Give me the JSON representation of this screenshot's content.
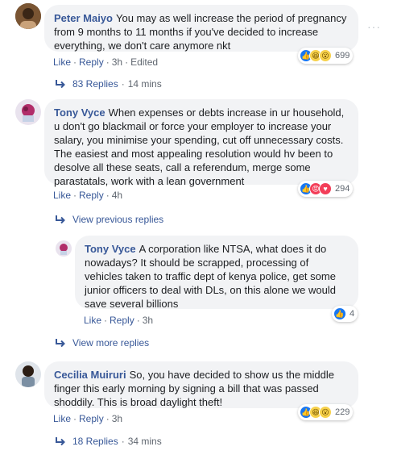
{
  "comments": [
    {
      "author": "Peter Maiyo",
      "text": "You may as well increase the period of pregnancy from 9 months to 11 months if you've decided to increase everything, we don't care anymore nkt",
      "actions": {
        "like": "Like",
        "reply": "Reply",
        "time": "3h",
        "edited": "Edited"
      },
      "reactions": {
        "icons": [
          "like-icon",
          "haha-icon",
          "wow-icon"
        ],
        "count": "699"
      },
      "replies_link": {
        "label": "83 Replies",
        "time": "14 mins"
      }
    },
    {
      "author": "Tony Vyce",
      "text": "When expenses or debts increase in ur household, u don't go blackmail or force your employer to increase your salary, you minimise your spending, cut off unnecessary costs. The easiest and most appealing resolution would hv been to desolve all these seats, call a referendum, merge some parastatals, work with a lean government",
      "actions": {
        "like": "Like",
        "reply": "Reply",
        "time": "4h"
      },
      "reactions": {
        "icons": [
          "like-icon",
          "angry-icon",
          "love-icon"
        ],
        "count": "294"
      },
      "previous_replies": "View previous replies",
      "reply": {
        "author": "Tony Vyce",
        "text": "A corporation like NTSA, what does it do nowadays? It should be scrapped, processing of vehicles taken to traffic dept of kenya police, get some junior officers to deal with DLs, on this alone we would save several billions",
        "actions": {
          "like": "Like",
          "reply": "Reply",
          "time": "3h"
        },
        "reactions": {
          "icons": [
            "like-icon"
          ],
          "count": "4"
        }
      },
      "more_replies": "View more replies"
    },
    {
      "author": "Cecilia Muiruri",
      "text": "So, you have decided to show us the middle finger this early morning by signing a bill that was passed shoddily. This is broad daylight theft!",
      "actions": {
        "like": "Like",
        "reply": "Reply",
        "time": "3h"
      },
      "reactions": {
        "icons": [
          "like-icon",
          "haha-icon",
          "wow-icon"
        ],
        "count": "229"
      },
      "replies_link": {
        "label": "18 Replies",
        "time": "34 mins"
      }
    }
  ],
  "more_options": "···"
}
